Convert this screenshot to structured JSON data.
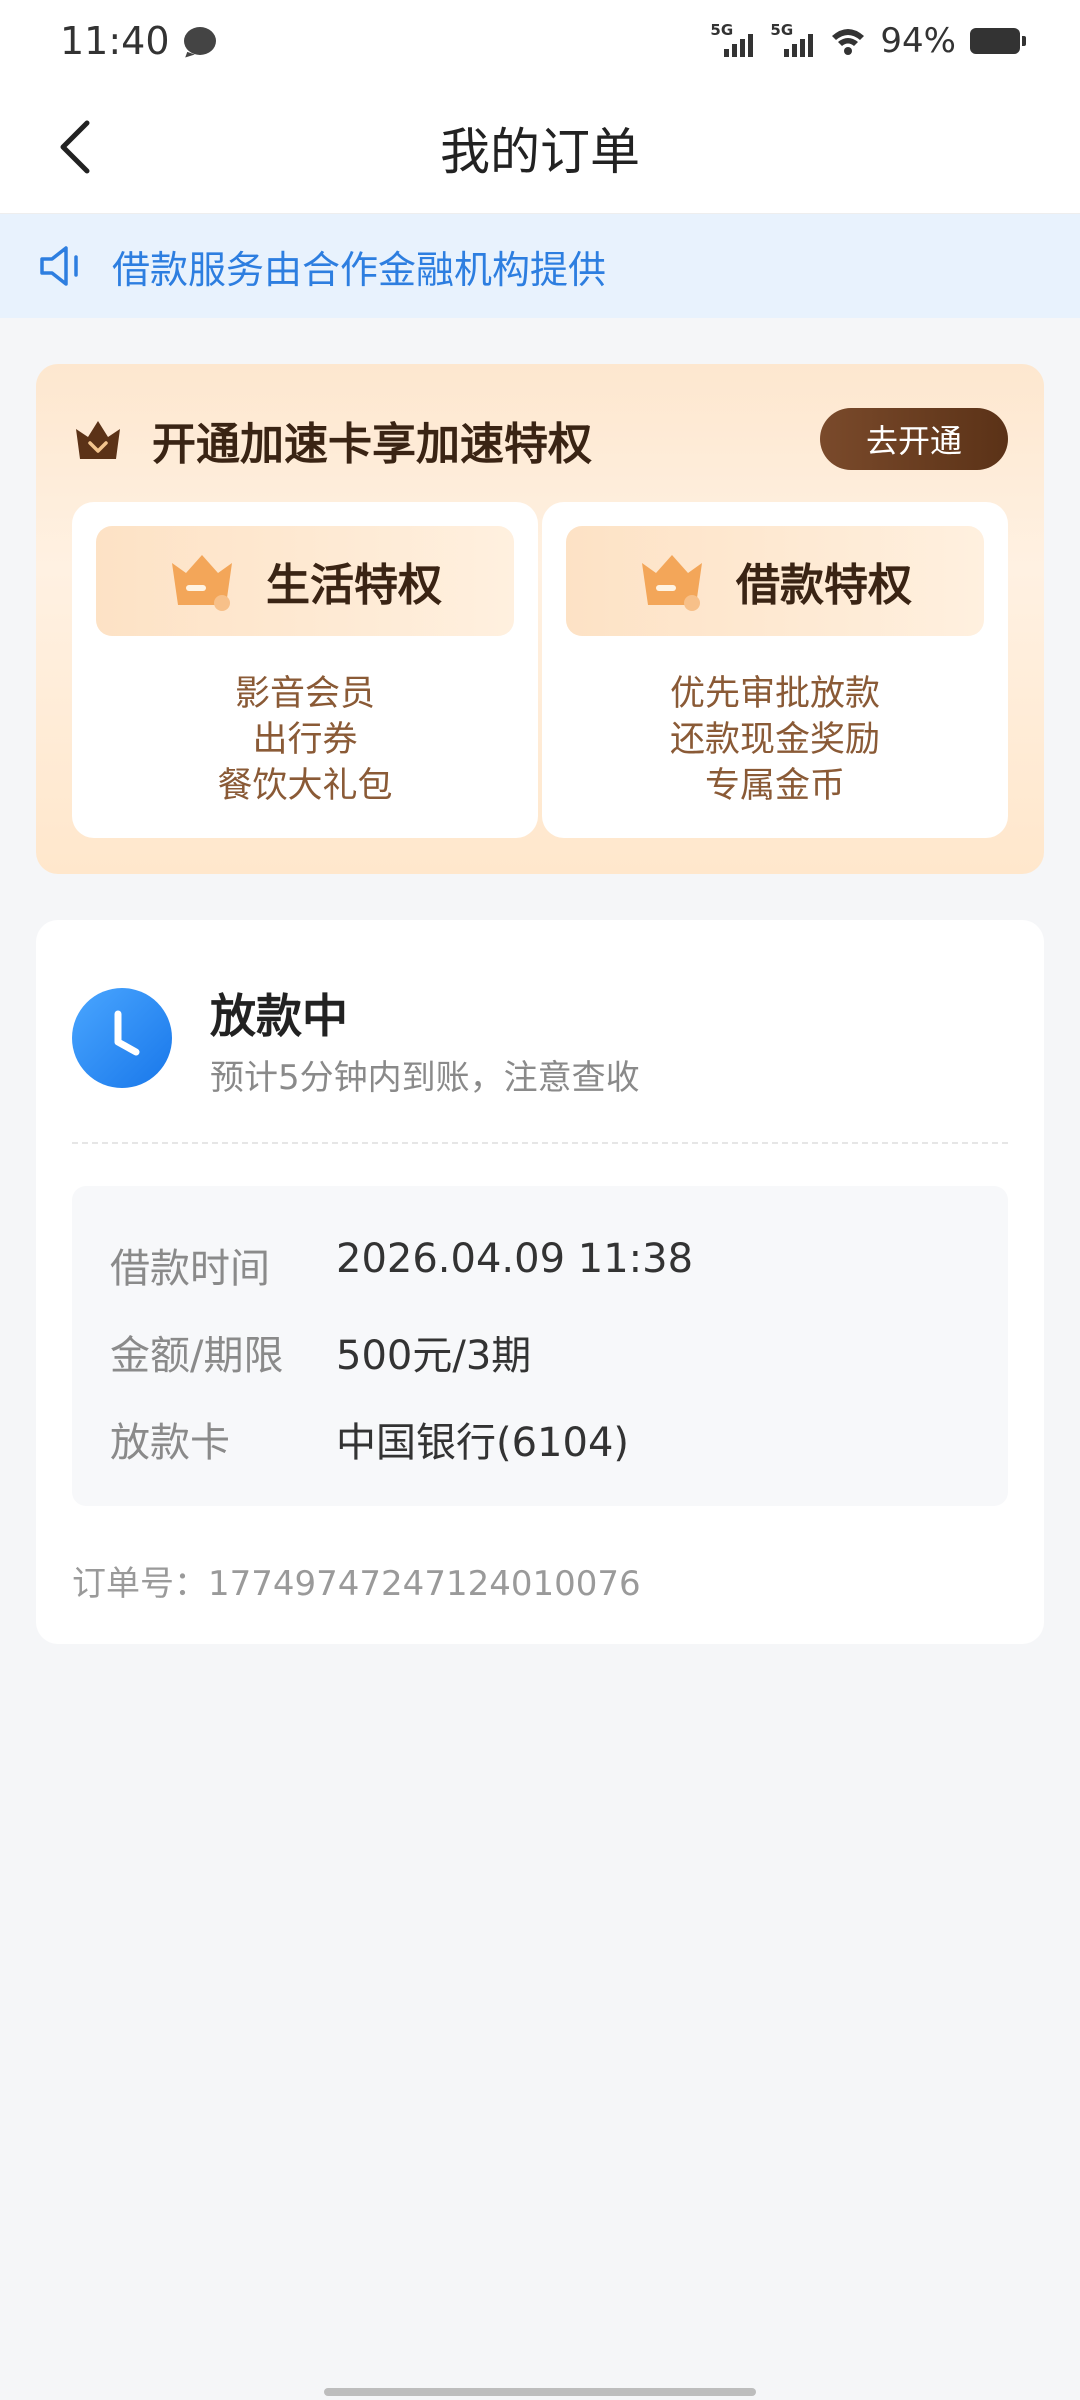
{
  "status_bar": {
    "time": "11:40",
    "signal1": "5G",
    "signal2": "5G",
    "battery": "94%"
  },
  "header": {
    "title": "我的订单"
  },
  "notice": {
    "text": "借款服务由合作金融机构提供"
  },
  "promo": {
    "title": "开通加速卡享加速特权",
    "button": "去开通",
    "privileges": [
      {
        "title": "生活特权",
        "items": [
          "影音会员",
          "出行券",
          "餐饮大礼包"
        ]
      },
      {
        "title": "借款特权",
        "items": [
          "优先审批放款",
          "还款现金奖励",
          "专属金币"
        ]
      }
    ]
  },
  "order": {
    "status": "放款中",
    "status_desc": "预计5分钟内到账，注意查收",
    "rows": [
      {
        "label": "借款时间",
        "value": "2026.04.09 11:38"
      },
      {
        "label": "金额/期限",
        "value": "500元/3期"
      },
      {
        "label": "放款卡",
        "value": "中国银行(6104)"
      }
    ],
    "order_no": "订单号：17749747247124010076"
  },
  "colors": {
    "accent_blue": "#2d7ee0",
    "status_blue": "#1f86f0",
    "promo_brown": "#6a3c1f",
    "notice_bg": "#e8f2fd"
  },
  "icons": {
    "back": "chevron-left-icon",
    "notice": "speaker-icon",
    "promo": "crown-icon",
    "status": "clock-icon"
  }
}
